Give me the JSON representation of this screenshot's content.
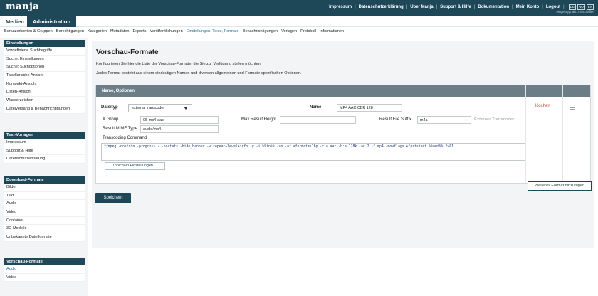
{
  "app": {
    "logo": "manja",
    "top_nav": [
      "Impressum",
      "Datenschutzerklärung",
      "Über Manja",
      "Support & Hilfe",
      "Dokumentation",
      "Mein Konto",
      "Logout"
    ],
    "languages": [
      "DE",
      "NO",
      "EN"
    ],
    "login_info": "eingeloggt als: mr.schaffer"
  },
  "main_tabs": [
    {
      "label": "Medien",
      "active": false
    },
    {
      "label": "Administration",
      "active": true
    }
  ],
  "sub_nav": [
    {
      "label": "Benutzerkonten & Gruppen",
      "active": false
    },
    {
      "label": "Berechtigungen",
      "active": false
    },
    {
      "label": "Kategorien",
      "active": false
    },
    {
      "label": "Metadaten",
      "active": false
    },
    {
      "label": "Exports",
      "active": false
    },
    {
      "label": "Veröffentlichungen",
      "active": false
    },
    {
      "label": "Einstellungen, Texte, Formate",
      "active": true
    },
    {
      "label": "Benachrichtigungen",
      "active": false
    },
    {
      "label": "Vorlagen",
      "active": false
    },
    {
      "label": "Protokoll",
      "active": false
    },
    {
      "label": "Informationen",
      "active": false
    }
  ],
  "sidebar": {
    "einstellungen": {
      "header": "Einstellungen",
      "items": [
        "Vordefinierte Suchbegriffe",
        "Suche: Einstellungen",
        "Suche: Suchoptionen",
        "Tabellarische Ansicht",
        "Kompakt-Ansicht",
        "Listen-Ansicht",
        "Wasserzeichen",
        "Dateiversand & Benachrichtigungen"
      ]
    },
    "text_vorlagen": {
      "header": "Text-Vorlagen",
      "items": [
        "Impressum",
        "Support & Hilfe",
        "Datenschutzerklärung"
      ]
    },
    "download_formate": {
      "header": "Download-Formate",
      "items": [
        "Bilder",
        "Text",
        "Audio",
        "Video",
        "Container",
        "3D-Modelle",
        "Unbekannte Dateiformate"
      ]
    },
    "vorschau_formate": {
      "header": "Vorschau-Formate",
      "items": [
        "Audio",
        "Video"
      ],
      "active_item": "Audio"
    }
  },
  "page": {
    "title": "Vorschau-Formate",
    "intro1": "Konfigurieren Sie hier die Liste der Vorschau-Formate, die Sie zur Verfügung stellen möchten.",
    "intro2": "Jedes Format besteht aus einem eindeutigen Namen und diversen allgemeinen und Formate-spezifischen Optionen.",
    "panel_header": "Name, Optionen",
    "form": {
      "dateityp_label": "Dateityp",
      "dateityp_value": "external transcoder",
      "name_label": "Name",
      "name_value": "MP4 AAC CBR 128",
      "xgroup_label": "X Group",
      "xgroup_value": "05-mp4-aac",
      "max_height_label": "Max Result Height",
      "max_height_value": "",
      "suffix_label": "Result File Suffix",
      "suffix_value": "m4a",
      "external_transcoder_label": "Externer Transcoder",
      "mime_label": "Result MIME Type",
      "mime_value": "audio/mp4",
      "command_label": "Transcoding Command",
      "command_value": "ffmpeg -nostdin -progress - -nostats -hide_banner -v repeat+level+info -y -i %%in%% -vn -af aformat=s16p -c:a aac -b:a 128k -ac 2 -f mp4 -movflags +faststart %%out%% 2>&1",
      "toolchain_button": "Toolchain Einstellungen ..."
    },
    "delete_label": "löschen",
    "add_button": "Weiteres Format hinzufügen",
    "save_button": "Speichern"
  },
  "colors": {
    "brand": "#1e4758",
    "panel_header": "#6b7e87",
    "active_link": "#1d6f94",
    "delete": "#c94236"
  }
}
